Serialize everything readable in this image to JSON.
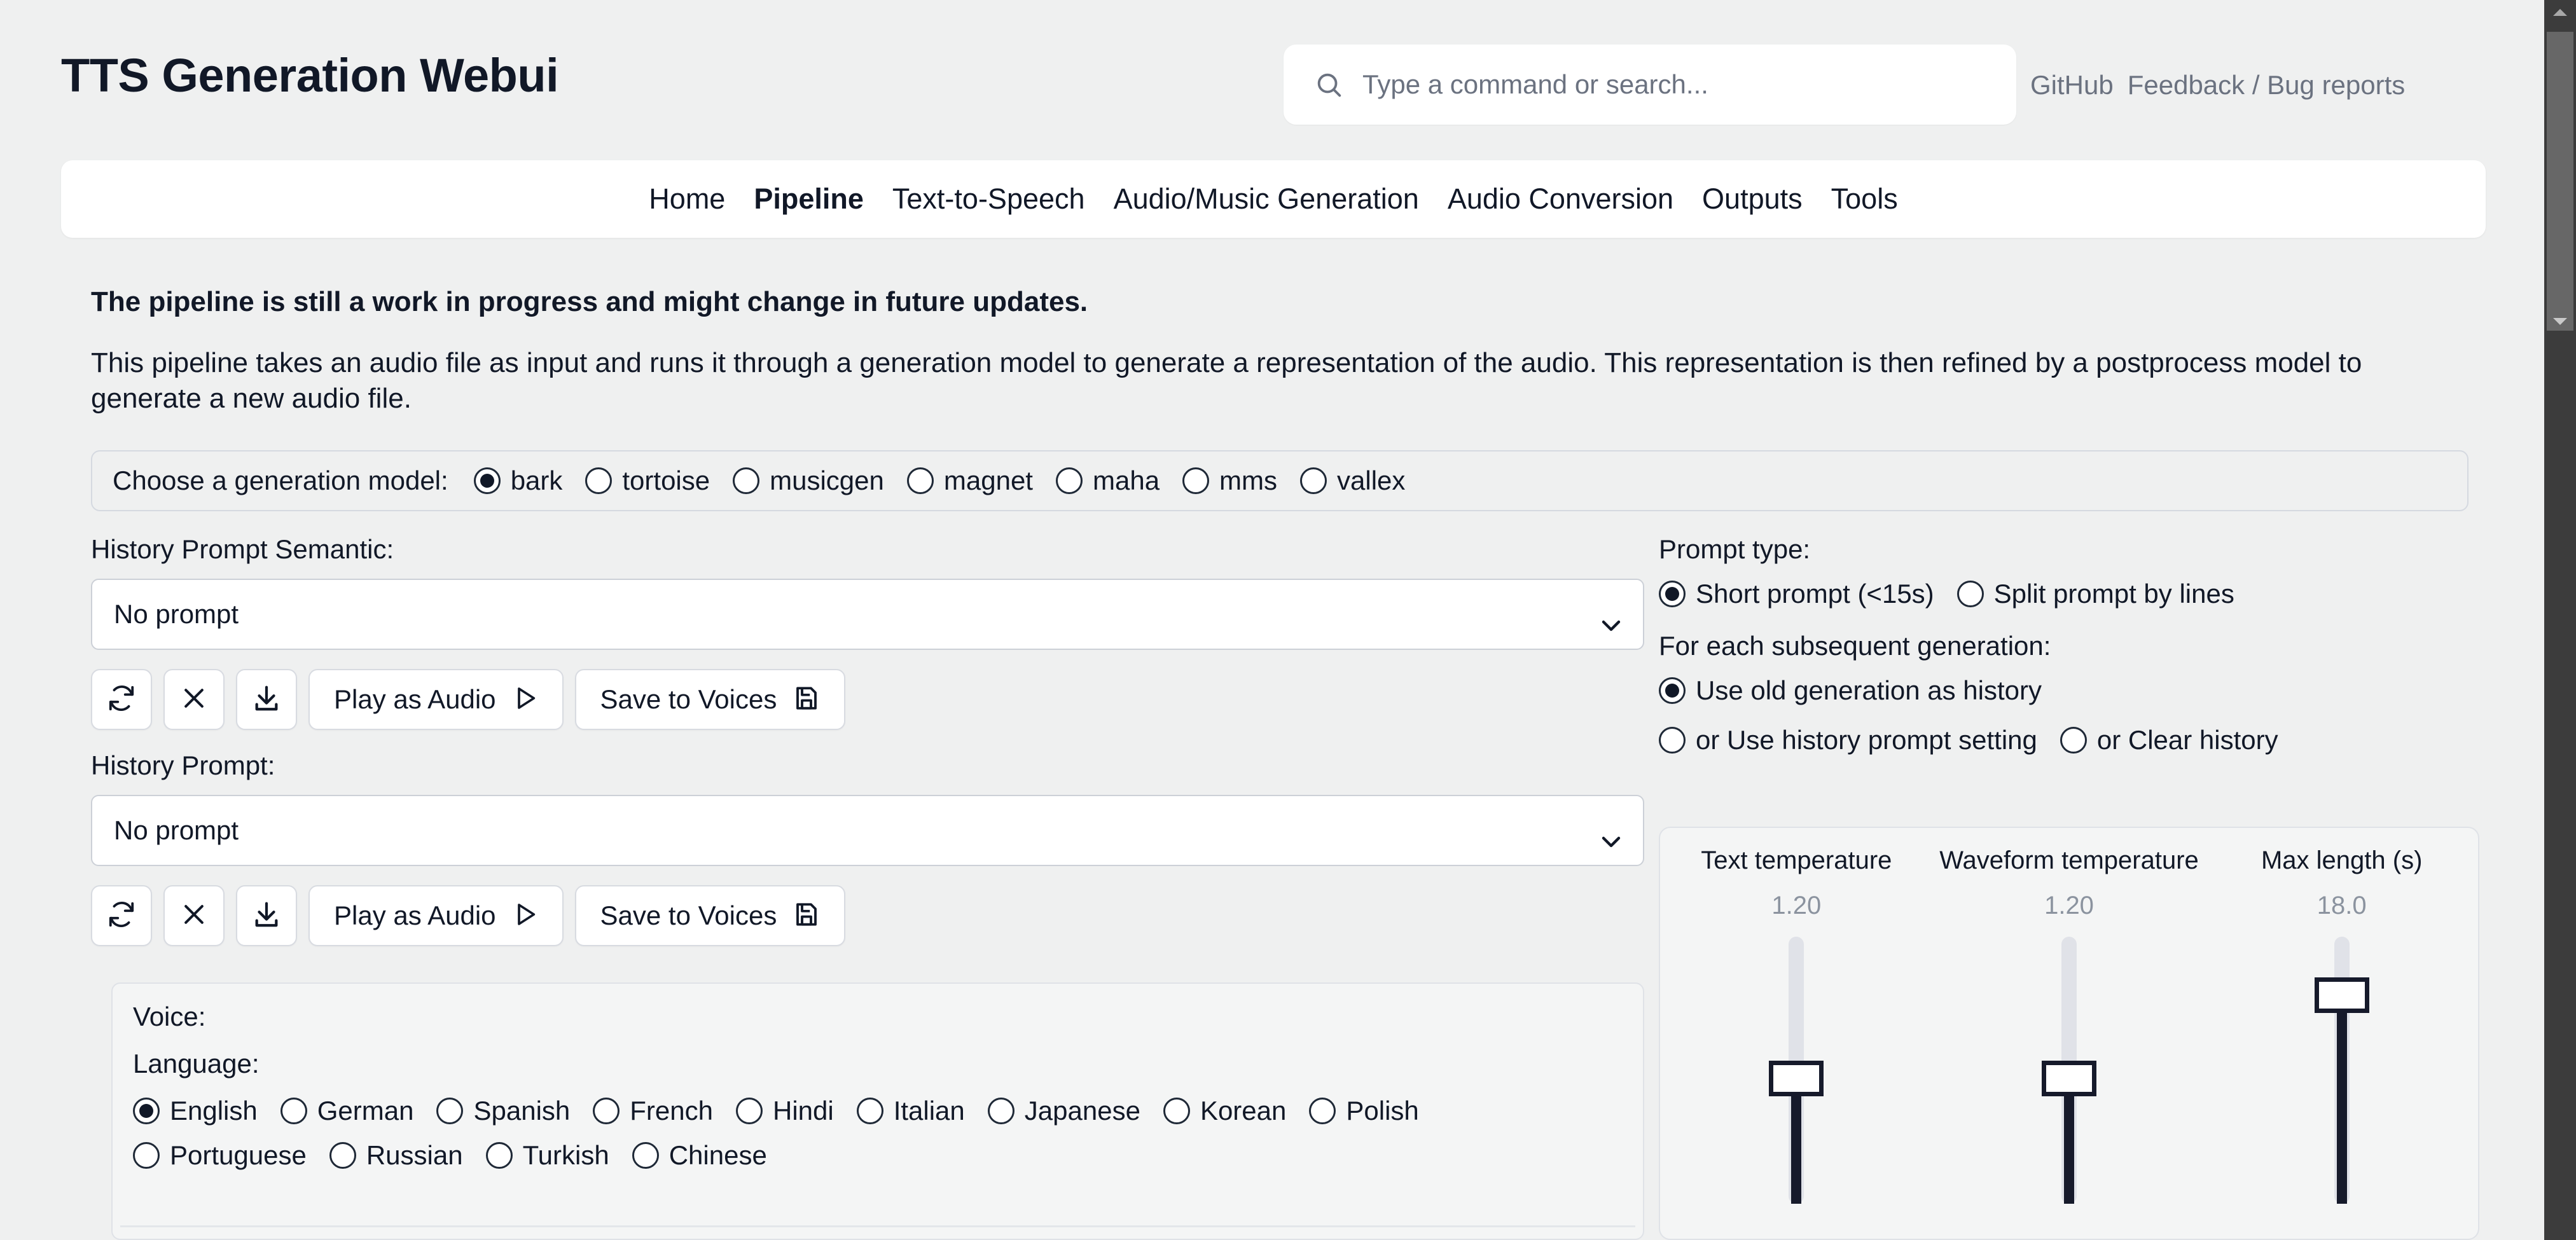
{
  "app": {
    "title": "TTS Generation Webui"
  },
  "search": {
    "placeholder": "Type a command or search...",
    "value": "",
    "icon": "search-icon"
  },
  "header_links": [
    {
      "label": "GitHub"
    },
    {
      "label": "Feedback / Bug reports"
    }
  ],
  "nav": {
    "items": [
      {
        "label": "Home",
        "active": false
      },
      {
        "label": "Pipeline",
        "active": true
      },
      {
        "label": "Text-to-Speech",
        "active": false
      },
      {
        "label": "Audio/Music Generation",
        "active": false
      },
      {
        "label": "Audio Conversion",
        "active": false
      },
      {
        "label": "Outputs",
        "active": false
      },
      {
        "label": "Tools",
        "active": false
      }
    ]
  },
  "content": {
    "notice": "The pipeline is still a work in progress and might change in future updates.",
    "description": "This pipeline takes an audio file as input and runs it through a generation model to generate a representation of the audio. This representation is then refined by a postprocess model to generate a new audio file."
  },
  "model_chooser": {
    "label": "Choose a generation model:",
    "selected": "bark",
    "options": [
      {
        "label": "bark",
        "checked": true
      },
      {
        "label": "tortoise",
        "checked": false
      },
      {
        "label": "musicgen",
        "checked": false
      },
      {
        "label": "magnet",
        "checked": false
      },
      {
        "label": "maha",
        "checked": false
      },
      {
        "label": "mms",
        "checked": false
      },
      {
        "label": "vallex",
        "checked": false
      }
    ]
  },
  "history_prompt_semantic": {
    "label": "History Prompt Semantic:",
    "value": "No prompt",
    "buttons": [
      {
        "name": "refresh",
        "icon": "refresh-icon",
        "label": ""
      },
      {
        "name": "clear",
        "icon": "close-icon",
        "label": ""
      },
      {
        "name": "download",
        "icon": "download-icon",
        "label": ""
      },
      {
        "name": "play",
        "icon": "play-icon",
        "label": "Play as Audio"
      },
      {
        "name": "save",
        "icon": "save-disk-icon",
        "label": "Save to Voices"
      }
    ]
  },
  "history_prompt": {
    "label": "History Prompt:",
    "value": "No prompt",
    "buttons": [
      {
        "name": "refresh",
        "icon": "refresh-icon",
        "label": ""
      },
      {
        "name": "clear",
        "icon": "close-icon",
        "label": ""
      },
      {
        "name": "download",
        "icon": "download-icon",
        "label": ""
      },
      {
        "name": "play",
        "icon": "play-icon",
        "label": "Play as Audio"
      },
      {
        "name": "save",
        "icon": "save-disk-icon",
        "label": "Save to Voices"
      }
    ]
  },
  "voice_panel": {
    "voice_label": "Voice:",
    "language_label": "Language:",
    "selected_language": "English",
    "languages_row1": [
      {
        "label": "English",
        "checked": true
      },
      {
        "label": "German",
        "checked": false
      },
      {
        "label": "Spanish",
        "checked": false
      },
      {
        "label": "French",
        "checked": false
      },
      {
        "label": "Hindi",
        "checked": false
      },
      {
        "label": "Italian",
        "checked": false
      },
      {
        "label": "Japanese",
        "checked": false
      },
      {
        "label": "Korean",
        "checked": false
      },
      {
        "label": "Polish",
        "checked": false
      }
    ],
    "languages_row2": [
      {
        "label": "Portuguese",
        "checked": false
      },
      {
        "label": "Russian",
        "checked": false
      },
      {
        "label": "Turkish",
        "checked": false
      },
      {
        "label": "Chinese",
        "checked": false
      }
    ]
  },
  "prompt_type": {
    "label": "Prompt type:",
    "selected": "Short prompt (<15s)",
    "options": [
      {
        "label": "Short prompt (<15s)",
        "checked": true
      },
      {
        "label": "Split prompt by lines",
        "checked": false
      }
    ]
  },
  "subsequent_generation": {
    "label": "For each subsequent generation:",
    "selected": "Use old generation as history",
    "options_row1": [
      {
        "label": "Use old generation as history",
        "checked": true
      }
    ],
    "options_row2": [
      {
        "label": "or Use history prompt setting",
        "checked": false
      },
      {
        "label": "or Clear history",
        "checked": false
      }
    ]
  },
  "sliders": [
    {
      "name": "Text temperature",
      "value": "1.20",
      "fill_pct": 47
    },
    {
      "name": "Waveform temperature",
      "value": "1.20",
      "fill_pct": 47
    },
    {
      "name": "Max length (s)",
      "value": "18.0",
      "fill_pct": 78
    }
  ],
  "colors": {
    "page_bg": "#eff0f0",
    "panel_bg": "#f4f5f5",
    "card_bg": "#ffffff",
    "text": "#111827",
    "muted": "#6b7280",
    "border": "#d8dbe1",
    "accent_dark": "#161a2b",
    "scrollbar_track": "#3c3c3c",
    "scrollbar_thumb": "#676767"
  }
}
